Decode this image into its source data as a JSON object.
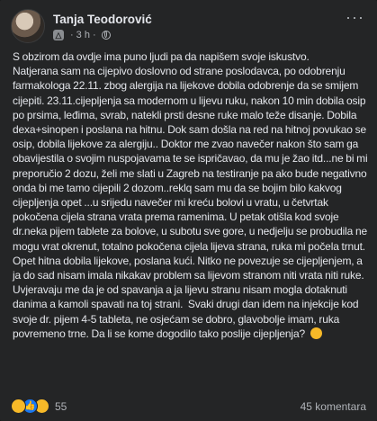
{
  "post": {
    "author": "Tanja Teodorović",
    "time": "3 h",
    "privacy_icon": "globe-icon",
    "body": "S obzirom da ovdje ima puno ljudi pa da napišem svoje iskustvo.\nNatjerana sam na cijepivo doslovno od strane poslodavca, po odobrenju farmakologa 22.11. zbog alergija na lijekove dobila odobrenje da se smijem cijepiti. 23.11.cijepljenja sa modernom u lijevu ruku, nakon 10 min dobila osip po prsima, leđima, svrab, natekli prsti desne ruke malo teže disanje. Dobila dexa+sinopen i poslana na hitnu. Dok sam došla na red na hitnoj povukao se osip, dobila lijekove za alergiju.. Doktor me zvao navečer nakon što sam ga obavijestila o svojim nuspojavama te se ispričavao, da mu je žao itd...ne bi mi preporučio 2 dozu, želi me slati u Zagreb na testiranje pa ako bude negativno onda bi me tamo cijepili 2 dozom..reklq sam mu da se bojim bilo kakvog cijepljenja opet ...u srijedu navečer mi kreću bolovi u vratu, u četvrtak pokočena cijela strana vrata prema ramenima. U petak otišla kod svoje dr.neka pijem tablete za bolove, u subotu sve gore, u nedjelju se probudila ne mogu vrat okrenut, totalno pokočena cijela lijeva strana, ruka mi počela trnut. Opet hitna dobila lijekove, poslana kući. Nitko ne povezuje se cijepljenjem, a ja do sad nisam imala nikakav problem sa lijevom stranom niti vrata niti ruke. Uvjeravaju me da je od spavanja a ja lijevu stranu nisam mogla dotaknuti danima a kamoli spavati na toj strani.  Svaki drugi dan idem na injekcije kod svoje dr. pijem 4-5 tableta, ne osjećam se dobro, glavobolje imam, ruka povremeno trne. Da li se kome dogodilo tako poslije cijepljenja?"
  },
  "footer": {
    "reaction_icons": [
      "sad-reaction-icon",
      "like-reaction-icon",
      "wow-reaction-icon"
    ],
    "reaction_count": "55",
    "comments": "45 komentara"
  },
  "colors": {
    "background": "#242526",
    "text": "#e4e6eb",
    "muted": "#b0b3b8",
    "like_blue": "#1877f2",
    "emoji_yellow": "#f7b928"
  }
}
